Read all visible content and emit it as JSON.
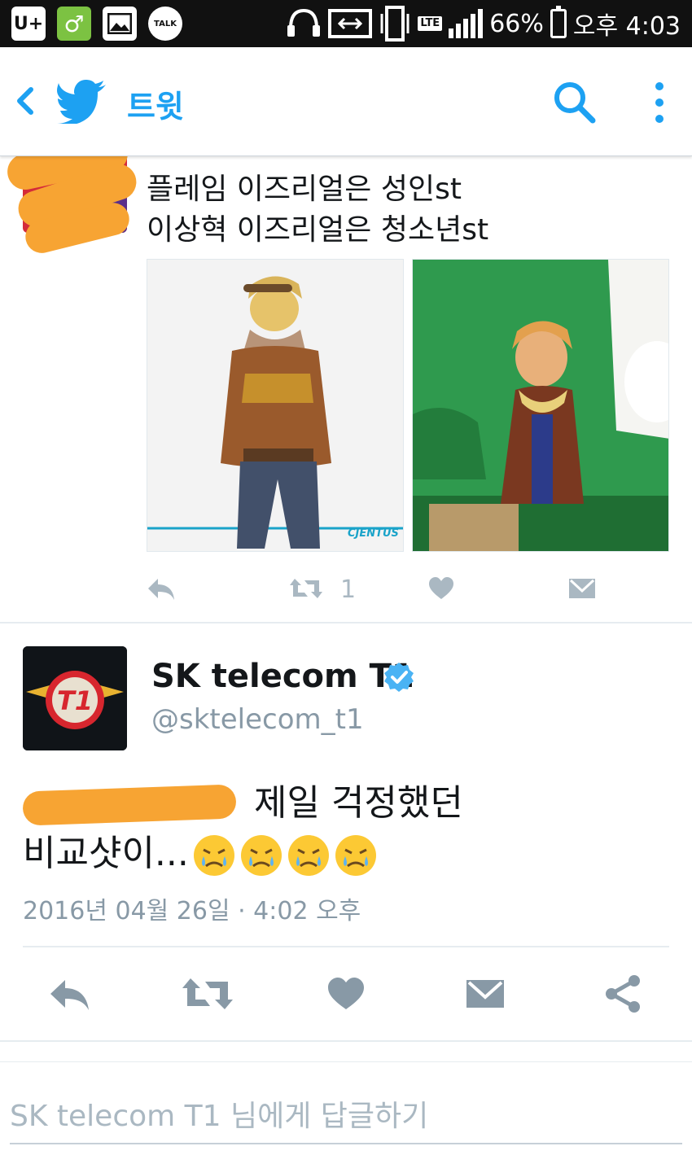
{
  "status_bar": {
    "carrier_icon": "U+",
    "kakaotalk_icon": "TALK",
    "network": "LTE",
    "battery_percent": "66%",
    "time": "오후 4:03"
  },
  "app_bar": {
    "title": "트윗"
  },
  "prev_tweet": {
    "text_line1": "플레임 이즈리얼은 성인st",
    "text_line2": "이상혁 이즈리얼은 청소년st",
    "retweet_count": "1",
    "photo2_watermark": "CJENTUS"
  },
  "main_tweet": {
    "name": "SK telecom T1",
    "handle": "@sktelecom_t1",
    "text_line1_suffix": "제일 걱정했던",
    "text_line2": "비교샷이...",
    "date": "2016년 04월 26일 · 4:02 오후"
  },
  "reply": {
    "placeholder": "SK telecom T1 님에게 답글하기"
  },
  "colors": {
    "twitter_blue": "#1da1f2",
    "action_gray": "#aab8c2",
    "scribble_orange": "#f7a433"
  }
}
